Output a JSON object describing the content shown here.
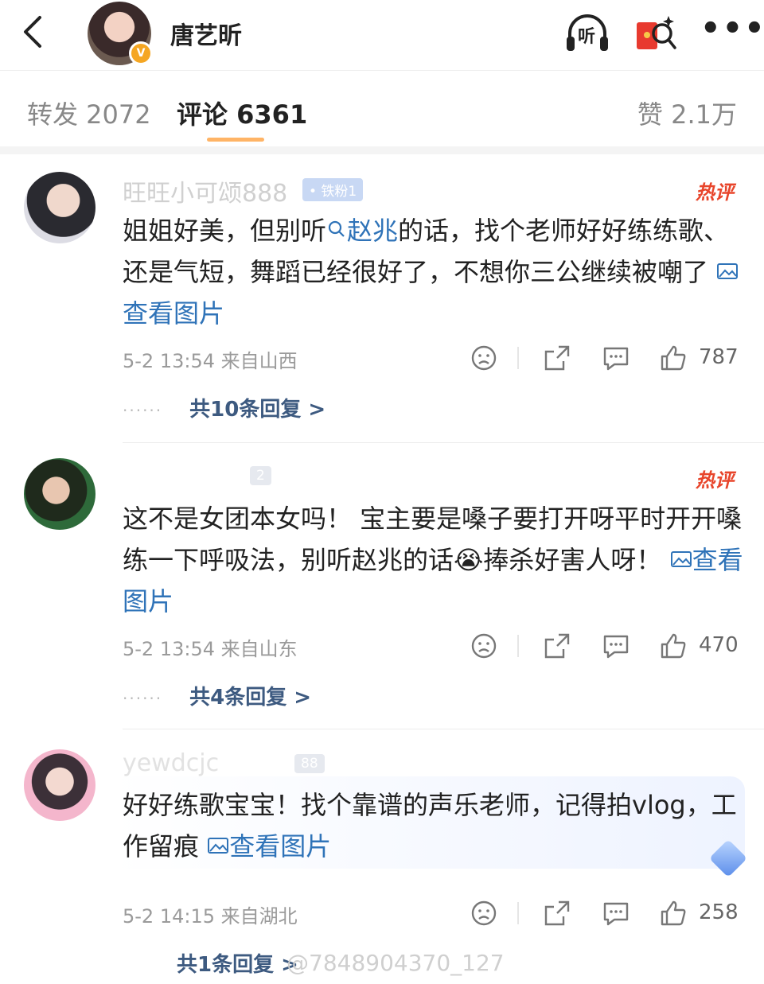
{
  "header": {
    "name": "唐艺昕",
    "listen_label": "听"
  },
  "tabs": {
    "repost": "转发 2072",
    "comment": "评论 6361",
    "like": "赞 2.1万"
  },
  "colors": {
    "accent": "#ff8200",
    "link": "#2f73b8",
    "hot": "#e8452b"
  },
  "comments": [
    {
      "name": "旺旺小可颂888",
      "badge": "• 铁粉1",
      "hot": "热评",
      "text_before": "姐姐好美，但别听",
      "link": "赵兆",
      "text_after": "的话，找个老师好好练练歌、还是气短，舞蹈已经很好了，不想你三公继续被嘲了",
      "image_link": "查看图片",
      "meta": "5-2 13:54  来自山西",
      "likes": "787",
      "replies": "共10条回复 >"
    },
    {
      "name": "",
      "badge": "2",
      "hot": "热评",
      "text_before": "这不是女团本女吗！ 宝主要是嗓子要打开呀平时开开嗓 练一下呼吸法，别听赵兆的话",
      "emoji": "😭",
      "text_after": "捧杀好害人呀！",
      "image_link": "查看图片",
      "meta": "5-2 13:54  来自山东",
      "likes": "470",
      "replies": "共4条回复 >"
    },
    {
      "name": "yewdcjc",
      "badge": "88",
      "text_before": "好好练歌宝宝！找个靠谱的声乐老师，记得拍vlog，工作留痕",
      "image_link": "查看图片",
      "meta": "5-2 14:15  来自湖北",
      "likes": "258",
      "replies": "共1条回复 >"
    }
  ],
  "watermark": "@7848904370_127"
}
